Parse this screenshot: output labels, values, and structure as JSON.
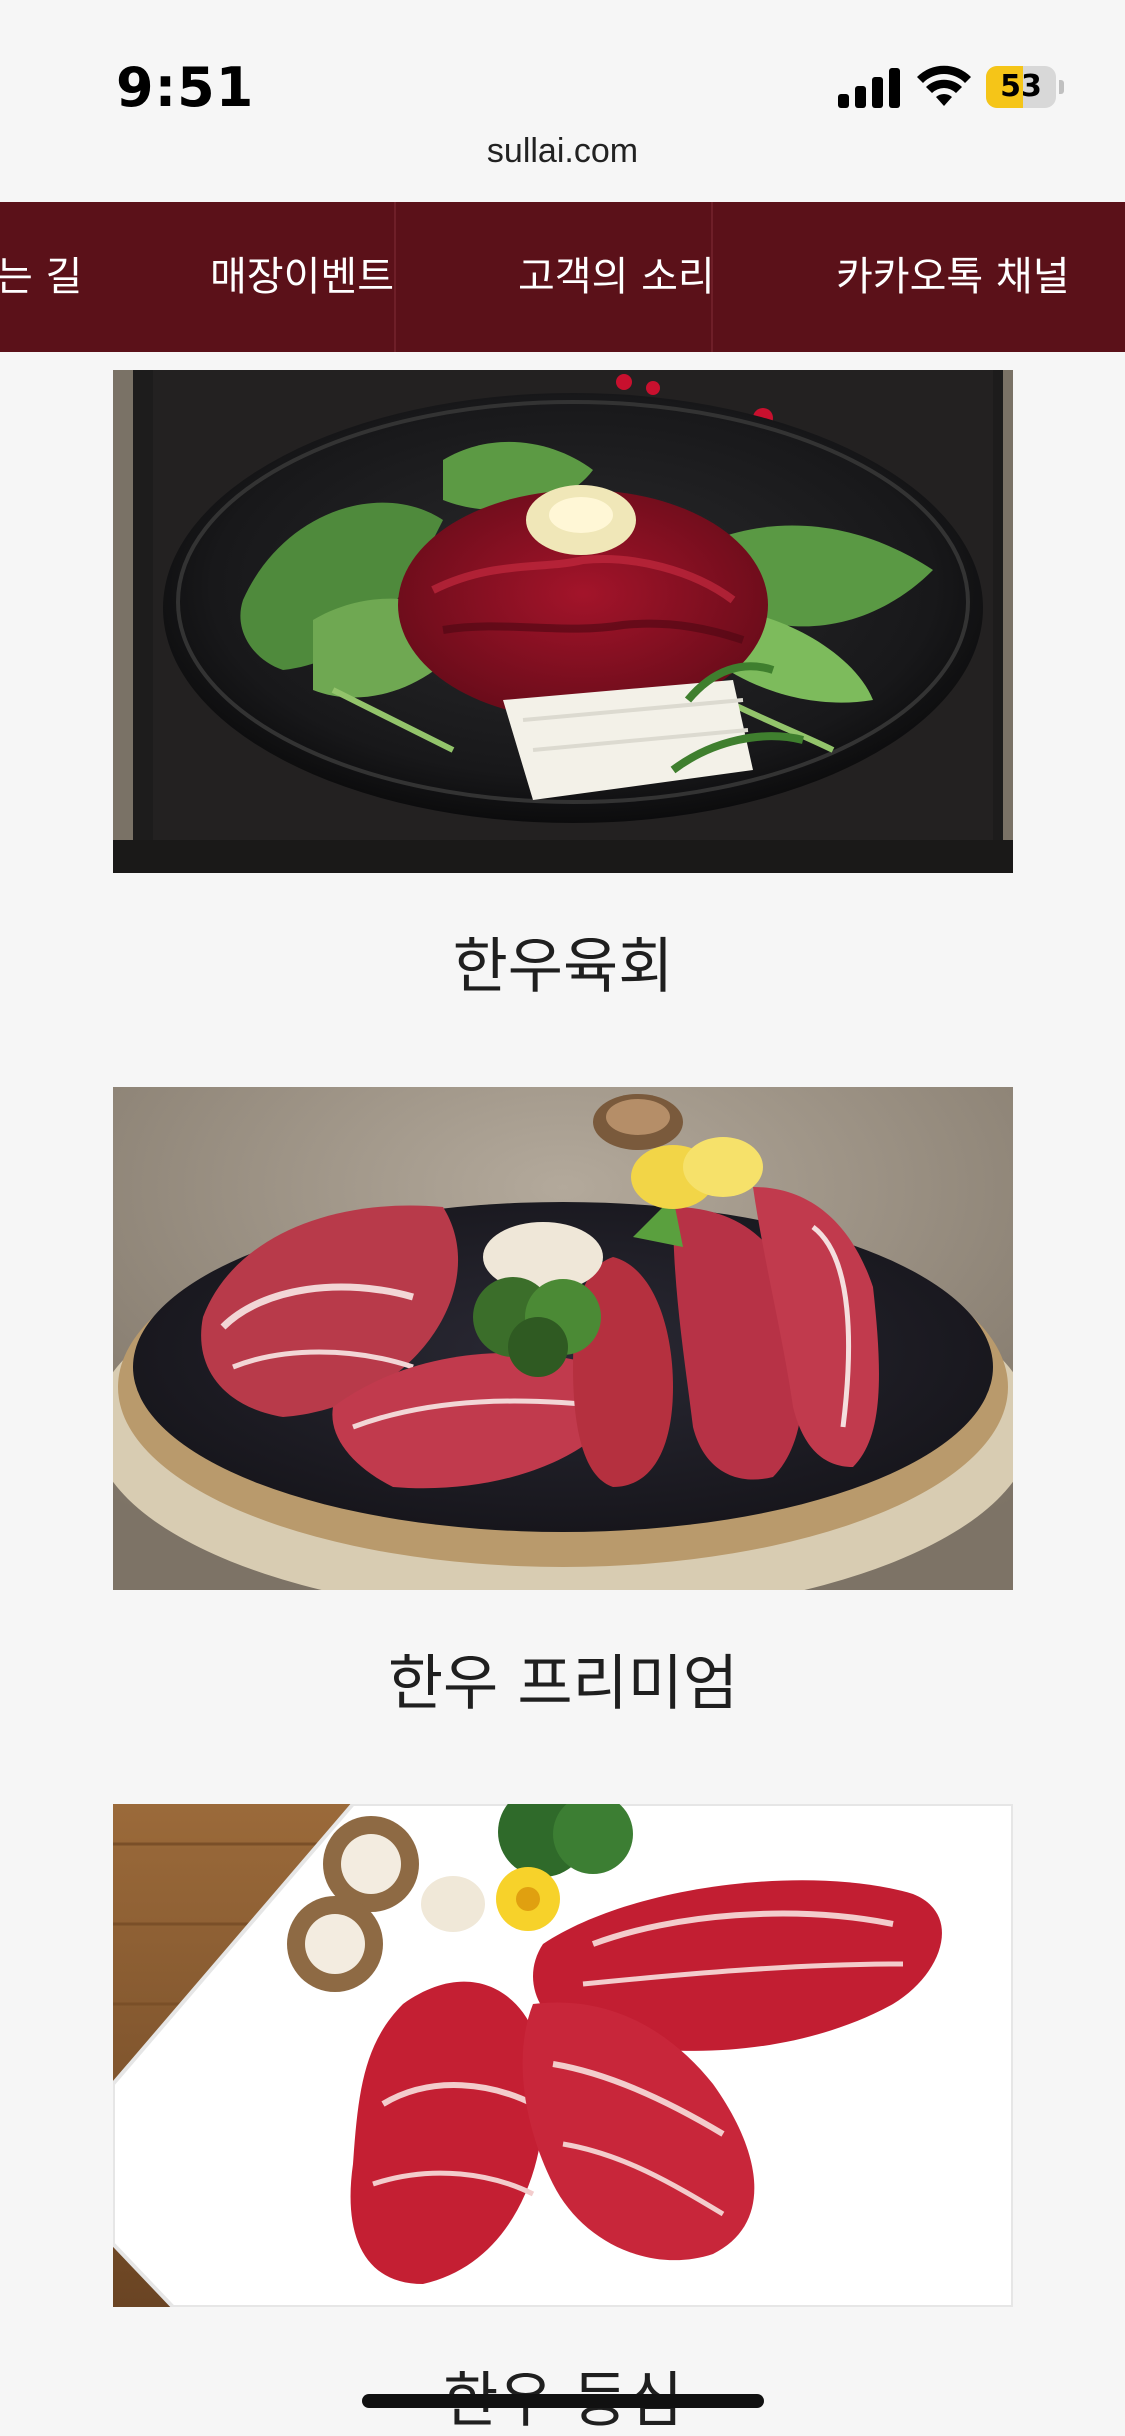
{
  "status_bar": {
    "time": "9:51",
    "battery_level": "53",
    "battery_color": "#f5c518",
    "icons": [
      "cellular-signal-icon",
      "wifi-icon",
      "battery-icon"
    ]
  },
  "browser": {
    "url": "sullai.com"
  },
  "nav": {
    "background": "#5b1119",
    "items": [
      {
        "label": "는 길"
      },
      {
        "label": "매장이벤트"
      },
      {
        "label": "고객의 소리"
      },
      {
        "label": "카카오톡 채널"
      }
    ]
  },
  "menu": [
    {
      "name": "한우육회"
    },
    {
      "name": "한우 프리미엄"
    },
    {
      "name": "한우 등심"
    }
  ]
}
